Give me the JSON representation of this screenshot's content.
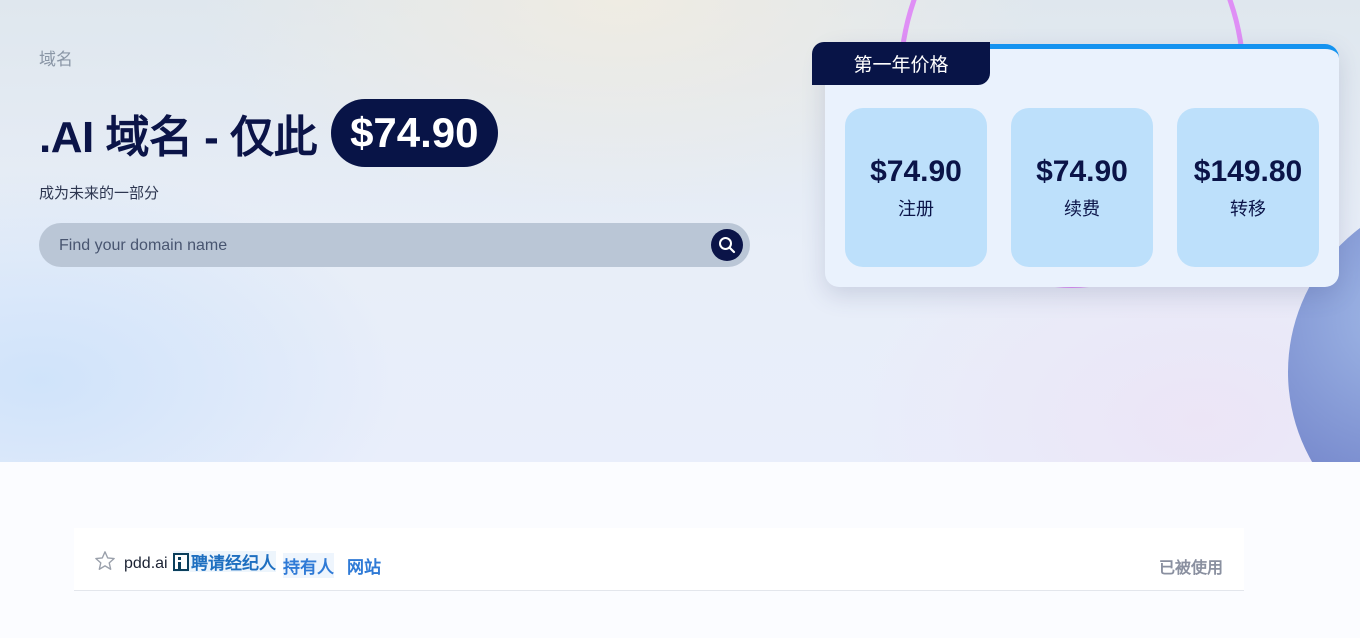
{
  "breadcrumb": "域名",
  "hero": {
    "headline": ".AI 域名 - 仅此",
    "price": "$74.90",
    "subtitle": "成为未来的一部分"
  },
  "search": {
    "placeholder": "Find your domain name",
    "value": ""
  },
  "pricing": {
    "tab_label": "第一年价格",
    "tiles": [
      {
        "price": "$74.90",
        "label": "注册"
      },
      {
        "price": "$74.90",
        "label": "续费"
      },
      {
        "price": "$149.80",
        "label": "转移"
      }
    ]
  },
  "domain_row": {
    "name": "pdd.ai",
    "broker_label": "聘请经纪人",
    "owner_link": "持有人",
    "site_link": "网站",
    "status": "已被使用"
  },
  "colors": {
    "navy": "#081447",
    "accent_blue": "#1493f0",
    "tile_bg": "#bde0fb",
    "link_blue": "#2f7ad6",
    "ring_pink": "#df8ff5"
  },
  "icons": [
    "search-icon",
    "star-icon",
    "broker-icon"
  ]
}
